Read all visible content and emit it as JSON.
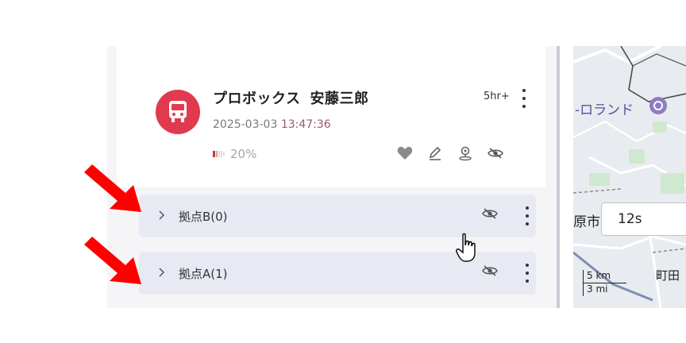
{
  "vehicle": {
    "name_part1": "プロボックス",
    "name_part2": "安藤三郎",
    "date": "2025-03-03",
    "time": "13:47:36",
    "battery": "20%",
    "last_seen": "5hr+"
  },
  "groups": [
    {
      "label": "拠点B(0)"
    },
    {
      "label": "拠点A(1)"
    }
  ],
  "map": {
    "poi_label": "-ロランド",
    "city_label": "原市",
    "town_label": "町田",
    "time_input_value": "12s",
    "scale_km": "5 km",
    "scale_mi": "3 mi"
  },
  "colors": {
    "avatar": "#e13a4e",
    "group_background": "#e8eaf3",
    "arrow": "#ff0000"
  },
  "icons": {
    "avatar": "bus-icon",
    "battery": "battery-low-icon",
    "actions": [
      "heart-icon",
      "edit-icon",
      "location-icon",
      "eye-hidden-icon"
    ]
  }
}
